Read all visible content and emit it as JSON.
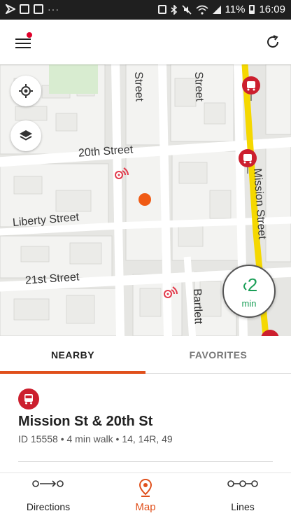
{
  "status_bar": {
    "battery": "11%",
    "time": "16:09",
    "dots": "···"
  },
  "app_bar": {
    "menu_icon": "hamburger-icon",
    "refresh_icon": "refresh-icon"
  },
  "map": {
    "streets": {
      "street_a": "Street",
      "street_b": "Street",
      "twentieth": "20th Street",
      "liberty": "Liberty Street",
      "twentyfirst": "21st Street",
      "mission": "Mission Street",
      "bartlett": "Bartlett"
    },
    "eta": {
      "value": "2",
      "unit": "min"
    },
    "colors": {
      "route": "#f5d800",
      "user": "#f05a14",
      "bus_stop": "#cc1f2e"
    }
  },
  "tabs": [
    {
      "label": "NEARBY",
      "active": true
    },
    {
      "label": "FAVORITES",
      "active": false
    }
  ],
  "stop": {
    "name": "Mission St & 20th St",
    "meta": "ID 15558 • 4 min walk • 14, 14R, 49"
  },
  "bottom_nav": [
    {
      "label": "Directions",
      "icon": "directions-icon",
      "active": false
    },
    {
      "label": "Map",
      "icon": "map-pin-icon",
      "active": true
    },
    {
      "label": "Lines",
      "icon": "lines-icon",
      "active": false
    }
  ]
}
